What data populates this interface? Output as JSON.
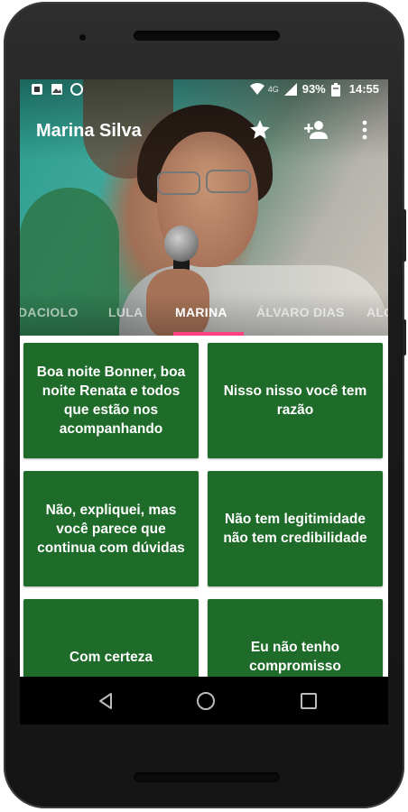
{
  "status_bar": {
    "icons_left": [
      "screenshot-icon",
      "image-icon",
      "circle-notification-icon"
    ],
    "network": "4G",
    "battery_percent": "93%",
    "time": "14:55"
  },
  "toolbar": {
    "title": "Marina Silva",
    "actions": [
      "star-icon",
      "add-person-icon",
      "more-vert-icon"
    ]
  },
  "tabs": [
    "DACIOLO",
    "LULA",
    "MARINA",
    "ÁLVARO DIAS",
    "ALCKMIN"
  ],
  "tab_visible_labels": [
    "DACIOLO",
    "LULA",
    "MARINA",
    "ÁLVARO DIAS",
    "ALC"
  ],
  "active_tab": "MARINA",
  "cards": [
    "Boa noite Bonner, boa noite Renata e todos que estão nos acompanhando",
    "Nisso nisso você tem razão",
    "Não, expliquei, mas você parece que continua com dúvidas",
    "Não tem legitimidade não tem credibilidade",
    "Com certeza",
    "Eu não tenho compromisso"
  ],
  "colors": {
    "card": "#1f6b2a",
    "indicator": "#ff4081",
    "navbar": "#000000"
  }
}
